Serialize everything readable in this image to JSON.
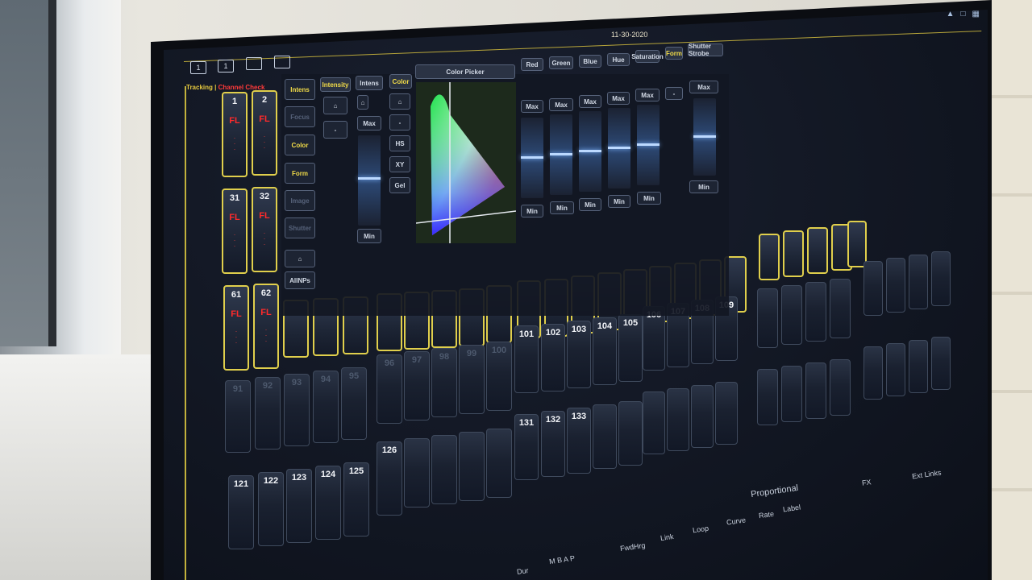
{
  "header": {
    "date": "11-30-2020"
  },
  "topbar": {
    "buttons": [
      "1",
      "1",
      "",
      ""
    ]
  },
  "tracking": {
    "mode": "Tracking",
    "alt": "Channel Check"
  },
  "channels_row1": [
    {
      "num": "1",
      "fl": "FL"
    },
    {
      "num": "2",
      "fl": "FL"
    }
  ],
  "channels_row2": [
    {
      "num": "31",
      "fl": "FL"
    },
    {
      "num": "32",
      "fl": "FL"
    }
  ],
  "channels_row3": [
    {
      "num": "61",
      "fl": "FL"
    },
    {
      "num": "62",
      "fl": "FL"
    }
  ],
  "grid_numbers": {
    "a": [
      "101",
      "102",
      "103",
      "104",
      "105"
    ],
    "b": [
      "106",
      "107",
      "108",
      "109"
    ],
    "c": [
      "131",
      "132",
      "133"
    ],
    "d": [
      "121",
      "122",
      "123",
      "124",
      "125"
    ],
    "e": [
      "126"
    ],
    "dim": [
      "91",
      "92",
      "93",
      "94",
      "95",
      "96",
      "97",
      "98",
      "99",
      "100"
    ]
  },
  "panel": {
    "categories": [
      "Intens",
      "Focus",
      "Color",
      "Form",
      "Image",
      "Shutter",
      "AllNPs"
    ],
    "intensity_label": "Intensity",
    "intens_tab": "Intens",
    "color_tab": "Color",
    "color_picker": "Color Picker",
    "max": "Max",
    "min": "Min",
    "dash": "-",
    "color_modes": [
      "HS",
      "XY",
      "Gel"
    ],
    "param_headers": [
      "Red",
      "Green",
      "Blue",
      "Hue",
      "Saturation",
      "Form",
      "Shutter Strobe"
    ]
  },
  "bottom": {
    "labels": [
      "Proportional",
      "FX",
      "Ext Links",
      "Label",
      "Rate",
      "Curve",
      "Loop",
      "Link",
      "FwdHrg"
    ],
    "flags": "M B A P",
    "dur": "Dur"
  }
}
